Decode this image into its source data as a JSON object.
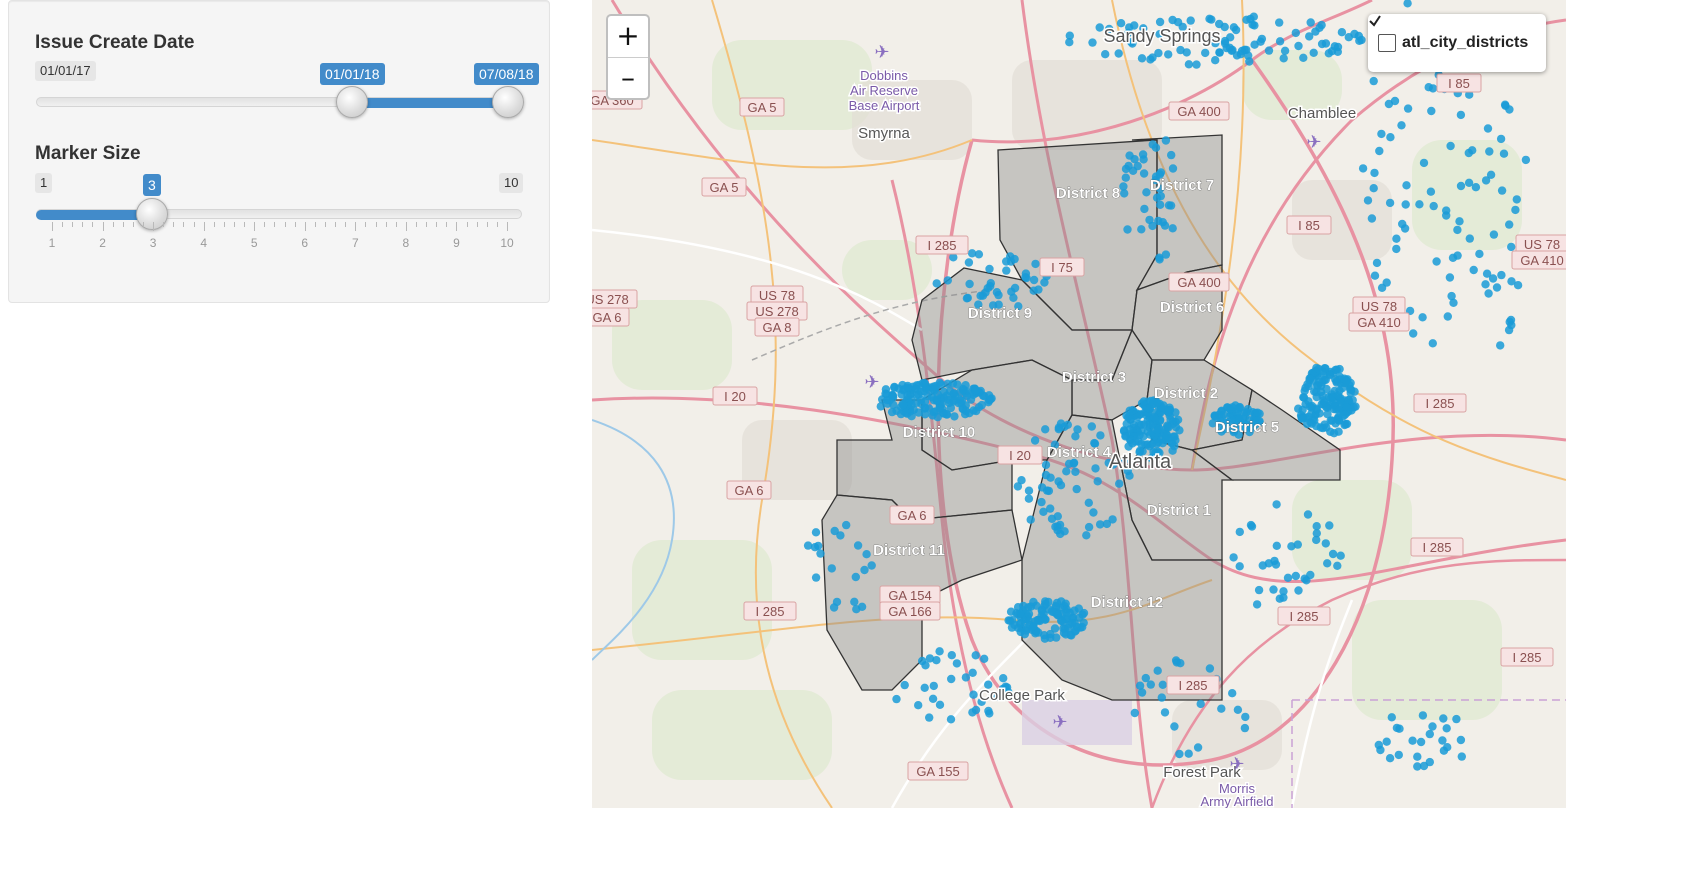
{
  "controls": {
    "date_slider": {
      "label": "Issue Create Date",
      "min_label": "01/01/17",
      "from_label": "01/01/18",
      "to_label": "07/08/18",
      "from_fraction": 0.635,
      "to_fraction": 1.0
    },
    "marker_slider": {
      "label": "Marker Size",
      "min_label": "1",
      "max_label": "10",
      "value_label": "3",
      "value": 3,
      "min": 1,
      "max": 10,
      "ticks": [
        "1",
        "2",
        "3",
        "4",
        "5",
        "6",
        "7",
        "8",
        "9",
        "10"
      ]
    },
    "accent_color": "#428bca"
  },
  "map": {
    "zoom_in": "+",
    "zoom_out": "–",
    "layer_control": {
      "label": "atl_city_districts",
      "checked": true
    },
    "marker_color": "#1a9bd7",
    "district_labels": [
      "District 1",
      "District 2",
      "District 3",
      "District 4",
      "District 5",
      "District 6",
      "District 7",
      "District 8",
      "District 9",
      "District 10",
      "District 11",
      "District 12"
    ],
    "places": [
      "Sandy Springs",
      "Chamblee",
      "Smyrna",
      "Atlanta",
      "College Park",
      "Forest Park",
      "Dobbins",
      "Air Reserve",
      "Base Airport",
      "Morris",
      "Army Airfield"
    ],
    "road_shields": [
      "GA 5",
      "GA 5",
      "US 78",
      "US 278",
      "GA 8",
      "I 285",
      "I 75",
      "GA 400",
      "GA 400",
      "I 85",
      "I 85",
      "US 78",
      "GA 410",
      "US 78",
      "GA 410",
      "I 20",
      "I 20",
      "GA 6",
      "GA 6",
      "I 285",
      "GA 154",
      "GA 166",
      "I 285",
      "I 285",
      "I 285",
      "I 285",
      "GA 155",
      "I 285",
      "GA 360",
      "US 278",
      "GA 6"
    ]
  }
}
